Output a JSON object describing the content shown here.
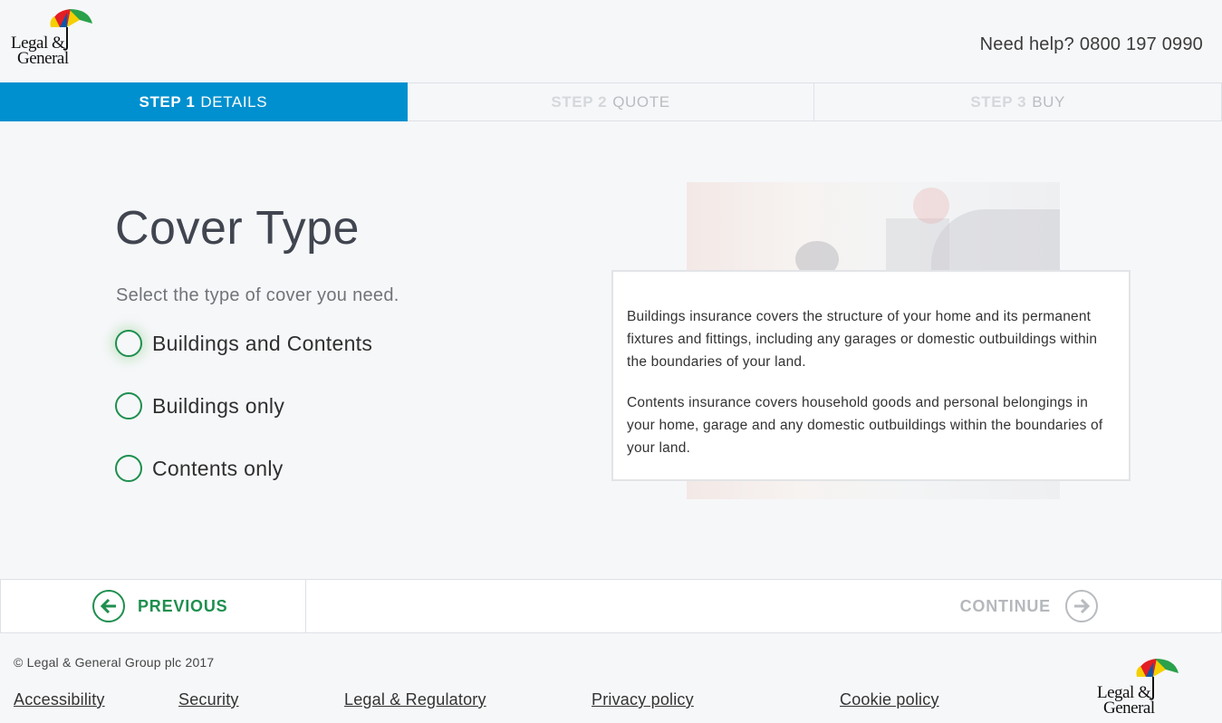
{
  "header": {
    "logo": {
      "line1": "Legal &",
      "line2": "General"
    },
    "help_label": "Need help?",
    "phone": "0800 197 0990"
  },
  "steps": [
    {
      "num": "STEP 1",
      "label": "DETAILS",
      "state": "active"
    },
    {
      "num": "STEP 2",
      "label": "QUOTE",
      "state": "inactive"
    },
    {
      "num": "STEP 3",
      "label": "BUY",
      "state": "inactive"
    }
  ],
  "main": {
    "title": "Cover Type",
    "subtitle": "Select the type of cover you need.",
    "options": [
      {
        "label": "Buildings and Contents",
        "selected": false
      },
      {
        "label": "Buildings only",
        "selected": false
      },
      {
        "label": "Contents only",
        "selected": false
      }
    ],
    "info": {
      "para1": "Buildings insurance covers the structure of your home and its permanent fixtures and fittings, including any garages or domestic outbuildings within the boundaries of your land.",
      "para2": "Contents insurance covers household goods and personal belongings in your home, garage and any domestic outbuildings within the boundaries of your land."
    }
  },
  "nav": {
    "previous_label": "PREVIOUS",
    "continue_label": "CONTINUE",
    "previous_icon": "arrow-left-icon",
    "continue_icon": "arrow-right-icon"
  },
  "footer": {
    "copyright": "© Legal & General Group plc 2017",
    "links": [
      "Accessibility",
      "Security",
      "Legal & Regulatory",
      "Privacy policy",
      "Cookie policy"
    ]
  },
  "colors": {
    "accent_blue": "#0090cf",
    "brand_green": "#1e8f4e",
    "background": "#f6f7f9",
    "muted": "#b5b8bc"
  }
}
